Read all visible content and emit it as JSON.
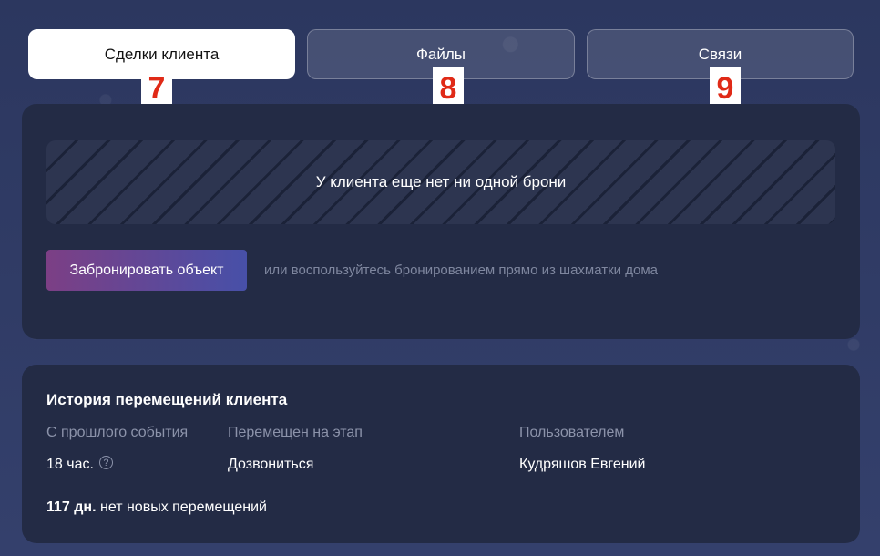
{
  "tabs": [
    {
      "label": "Сделки клиента",
      "active": true,
      "marker": "7"
    },
    {
      "label": "Файлы",
      "active": false,
      "marker": "8"
    },
    {
      "label": "Связи",
      "active": false,
      "marker": "9"
    }
  ],
  "deals": {
    "empty_text": "У клиента еще нет ни одной брони",
    "book_button": "Забронировать объект",
    "hint": "или воспользуйтесь бронированием прямо из шахматки дома"
  },
  "history": {
    "title": "История перемещений клиента",
    "columns": [
      "С прошлого события",
      "Перемещен на этап",
      "Пользователем"
    ],
    "row": {
      "since": "18 час.",
      "stage": "Дозвониться",
      "user": "Кудряшов Евгений"
    },
    "help_glyph": "?",
    "summary_bold": "117 дн.",
    "summary_text": "нет новых перемещений"
  },
  "colors": {
    "background": "#2f3a63",
    "panel": "#232b45",
    "button_gradient_start": "#7c3f85",
    "button_gradient_end": "#4750a8",
    "marker_text": "#e02a17"
  }
}
